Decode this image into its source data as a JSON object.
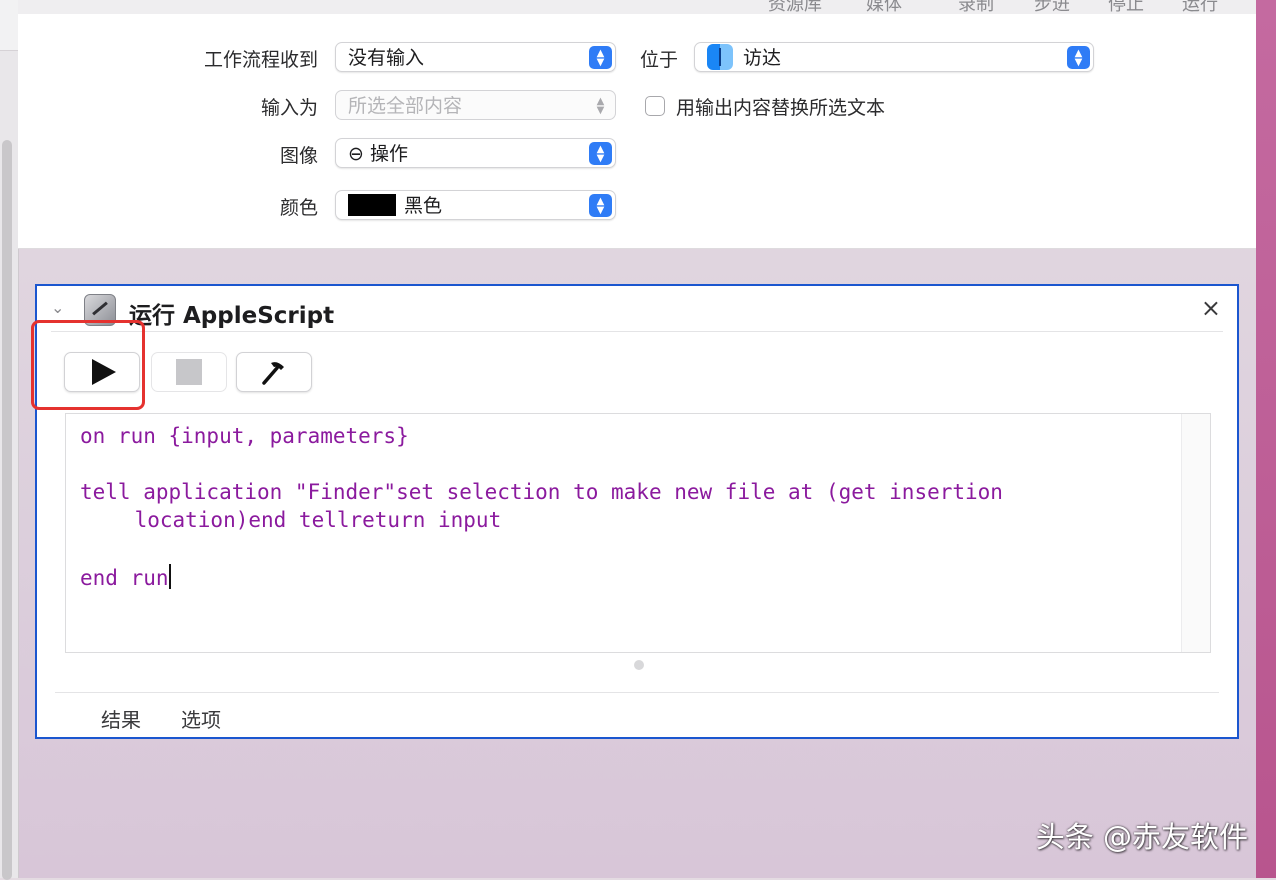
{
  "toolbar_partial": [
    "资源库",
    "媒体",
    "录制",
    "步进",
    "停止",
    "运行"
  ],
  "workflow": {
    "receives_label": "工作流程收到",
    "receives_value": "没有输入",
    "in_label": "位于",
    "in_value": "访达",
    "input_is_label": "输入为",
    "input_is_value": "所选全部内容",
    "replace_label": "用输出内容替换所选文本",
    "image_label": "图像",
    "image_value": "⊖ 操作",
    "color_label": "颜色",
    "color_value": "黑色",
    "color_swatch": "#000000"
  },
  "action": {
    "title": "运行 AppleScript",
    "close_glyph": "×",
    "chevron_glyph": "⌄",
    "code_lines": [
      "on run {input, parameters}",
      "tell application \"Finder\"set selection to make new file at (get insertion",
      "    location)end tellreturn input",
      "end run"
    ],
    "tabs": [
      "结果",
      "选项"
    ]
  },
  "colors": {
    "accent": "#2f7cf6",
    "code": "#8b1a9e",
    "action_border": "#1b56cf",
    "highlight": "#e5322f"
  },
  "watermark": "头条 @赤友软件"
}
